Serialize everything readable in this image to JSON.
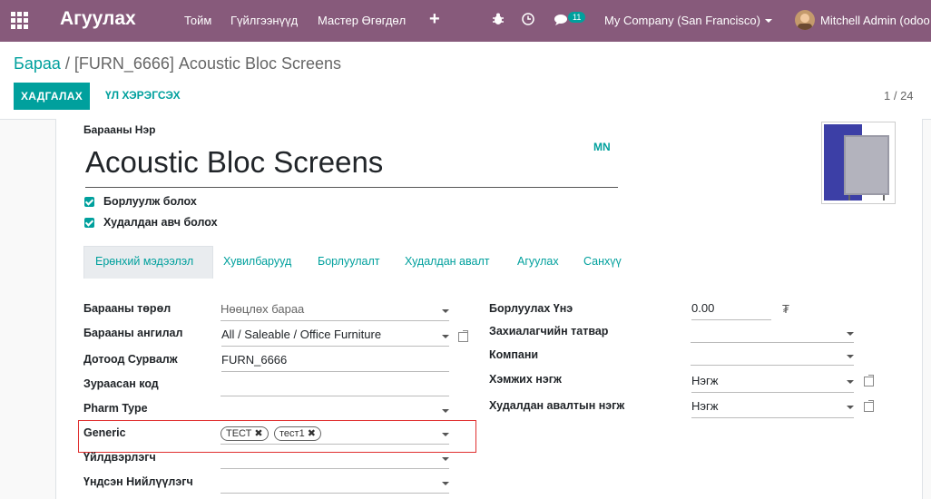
{
  "navbar": {
    "brand": "Агуулах",
    "menus": [
      "Тойм",
      "Гүйлгээнүүд",
      "Мастер Өгөгдөл"
    ],
    "plus": "+",
    "chat_count": "11",
    "company": "My Company (San Francisco)",
    "user": "Mitchell Admin (odoo"
  },
  "breadcrumb": {
    "parent": "Бараа",
    "separator": " / ",
    "current": "[FURN_6666] Acoustic Bloc Screens"
  },
  "actions": {
    "save": "ХАДГАЛАХ",
    "tools": "ҮЛ ХЭРЭГСЭХ"
  },
  "pager": "1 / 24",
  "product": {
    "name_label": "Барааны Нэр",
    "name": "Acoustic Bloc Screens",
    "lang": "MN",
    "can_sell": "Борлуулж болох",
    "can_buy": "Худалдан авч болох"
  },
  "tabs": [
    "Ерөнхий мэдээлэл",
    "Хувилбарууд",
    "Борлуулалт",
    "Худалдан авалт",
    "Агуулах",
    "Санхүү"
  ],
  "left_fields": {
    "type_label": "Барааны төрөл",
    "type_value": "Нөөцлөх бараа",
    "category_label": "Барааны ангилал",
    "category_value": "All / Saleable / Office Furniture",
    "ref_label": "Дотоод Сурвалж",
    "ref_value": "FURN_6666",
    "barcode_label": "Зураасан код",
    "pharm_label": "Pharm Type",
    "generic_label": "Generic",
    "generic_tags": [
      "ТЕСТ",
      "тест1"
    ],
    "manufacturer_label": "Үйлдвэрлэгч",
    "supplier_label": "Үндсэн Нийлүүлэгч"
  },
  "right_fields": {
    "price_label": "Борлуулах Үнэ",
    "price_value": "0.00",
    "currency": "₮",
    "tax_label": "Захиалагчийн татвар",
    "company_label": "Компани",
    "uom_label": "Хэмжих нэгж",
    "uom_value": "Нэгж",
    "puom_label": "Худалдан авалтын нэгж",
    "puom_value": "Нэгж"
  },
  "colors": {
    "brand": "#875A7B",
    "accent": "#00A09D",
    "highlight": "#e03030"
  }
}
